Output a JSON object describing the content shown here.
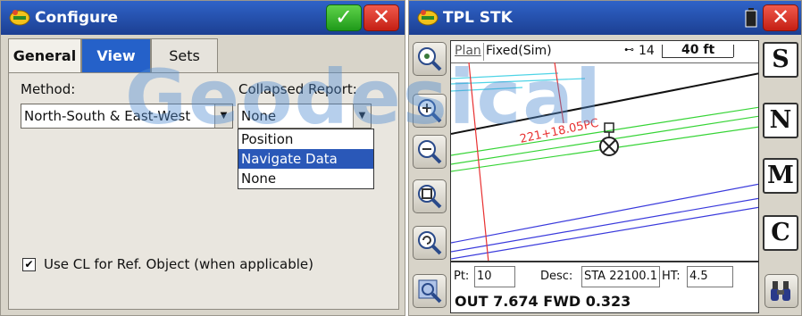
{
  "configure": {
    "title": "Configure",
    "tabs": [
      "General",
      "View",
      "Sets"
    ],
    "method_label": "Method:",
    "method_value": "North-South & East-West",
    "collapsed_label": "Collapsed Report:",
    "collapsed_value": "None",
    "dropdown_options": [
      "Position",
      "Navigate Data",
      "None"
    ],
    "dropdown_selected": "Navigate Data",
    "checkbox_label": "Use CL for Ref. Object (when applicable)",
    "checkbox_checked": true
  },
  "watermark": "Geodesical",
  "stakeout": {
    "title": "TPL STK",
    "plan_label": "Plan",
    "fix_status": "Fixed(Sim)",
    "satellites": "14",
    "scale_label": "40 ft",
    "station_label": "221+18.05PC",
    "side_buttons": [
      "S",
      "N",
      "M",
      "C"
    ],
    "pt_label": "Pt:",
    "pt_value": "10",
    "desc_label": "Desc:",
    "desc_value": "STA 22100.1",
    "ht_label": "HT:",
    "ht_value": "4.5",
    "nav_readout": "OUT 7.674 FWD 0.323"
  }
}
